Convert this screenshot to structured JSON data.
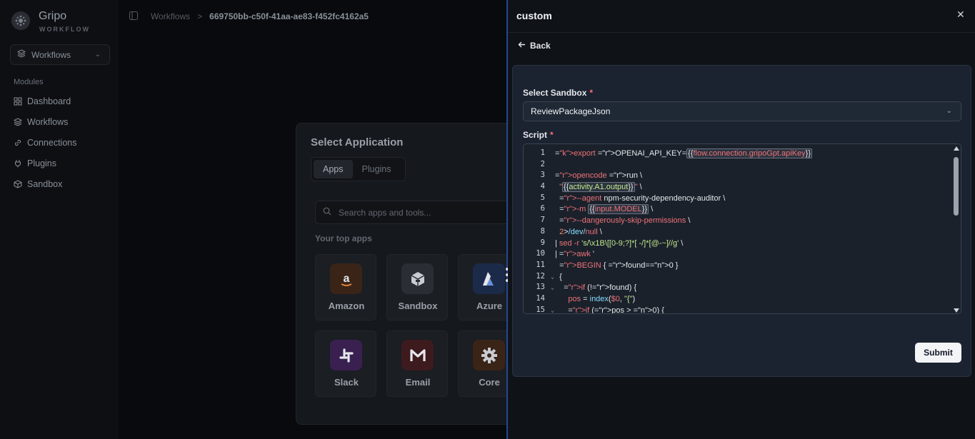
{
  "sidebar": {
    "brand": "Gripo",
    "brand_sub": "WORKFLOW",
    "workspace": "Workflows",
    "section": "Modules",
    "items": [
      {
        "label": "Dashboard",
        "icon": "grid-icon"
      },
      {
        "label": "Workflows",
        "icon": "layers-icon"
      },
      {
        "label": "Connections",
        "icon": "link-icon"
      },
      {
        "label": "Plugins",
        "icon": "plug-icon"
      },
      {
        "label": "Sandbox",
        "icon": "box-icon"
      }
    ]
  },
  "breadcrumb": {
    "root": "Workflows",
    "separator": ">",
    "current": "669750bb-c50f-41aa-ae83-f452fc4162a5"
  },
  "select_app": {
    "title": "Select Application",
    "tabs": [
      "Apps",
      "Plugins"
    ],
    "search_placeholder": "Search apps and tools...",
    "top_apps_label": "Your top apps",
    "apps": [
      {
        "label": "Amazon",
        "icon": "amazon-icon",
        "color": "#ea8a3b"
      },
      {
        "label": "Sandbox",
        "icon": "box-icon",
        "color": "#c9ccd1"
      },
      {
        "label": "Azure",
        "icon": "azure-icon",
        "color": "#4f7dd9"
      },
      {
        "label": "Slack",
        "icon": "slack-icon",
        "color": "#b07ad6"
      },
      {
        "label": "Email",
        "icon": "gmail-icon",
        "color": "#e25555"
      },
      {
        "label": "Core",
        "icon": "gear-icon",
        "color": "#c9ccd1"
      }
    ]
  },
  "panel": {
    "title": "custom",
    "close_label": "✕",
    "back_label": "Back",
    "sandbox_label": "Select Sandbox",
    "required_mark": "*",
    "sandbox_value": "ReviewPackageJson",
    "script_label": "Script",
    "submit_label": "Submit"
  },
  "script": {
    "line_numbers": [
      "1",
      "2",
      "3",
      "4",
      "5",
      "6",
      "7",
      "8",
      "9",
      "10",
      "11",
      "12",
      "13",
      "14",
      "15"
    ],
    "folded_lines": [
      "12",
      "13",
      "15"
    ],
    "lines": [
      "export OPENAI_API_KEY={{flow.connection.gripoGpt.apiKey}}",
      "",
      "opencode run \\",
      "  \"{{activity.A1.output}}\" \\",
      "  --agent npm-security-dependency-auditor \\",
      "  -m {{input.MODEL}} \\",
      "  --dangerously-skip-permissions \\",
      "  2>/dev/null \\",
      "| sed -r 's/\\x1B\\[[0-9;?]*[ -/]*[@-~]//g' \\",
      "| awk '",
      "  BEGIN { found=0 }",
      "  {",
      "    if (!found) {",
      "      pos = index($0, \"{\")",
      "      if (pos > 0) {"
    ]
  }
}
